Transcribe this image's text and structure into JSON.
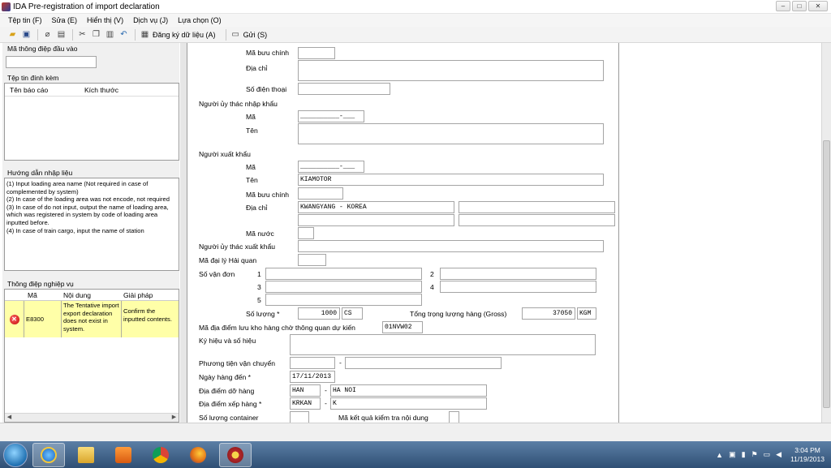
{
  "window": {
    "title": "IDA Pre-registration of import declaration",
    "buttons": [
      "–",
      "□",
      "✕"
    ]
  },
  "menu": [
    "Tệp tin (F)",
    "Sửa (E)",
    "Hiển thị (V)",
    "Dịch vụ (J)",
    "Lựa chọn (O)"
  ],
  "toolbar": {
    "register_label": "Đăng ký dữ liệu (A)",
    "send_label": "Gửi (S)"
  },
  "left": {
    "input_message_label": "Mã thông điệp đầu vào",
    "attachments_label": "Tệp tin đính kèm",
    "attachments_cols": [
      "Tên báo cáo",
      "Kích thước"
    ],
    "guide_label": "Hướng dẫn nhập liệu",
    "guide_text": "(1) Input loading area name (Not required in case of complemented by system)\n(2) In case of the loading area was not encode, not required\n(3) In case of do not input, output the name of loading area, which was registered in system by code of loading area inputted before.\n(4) In case of train cargo, input the name of station",
    "business_label": "Thông điệp nghiệp vụ",
    "business_cols": [
      "Mã",
      "Nội dung",
      "Giải pháp"
    ],
    "business_row": {
      "code": "E8300",
      "content": "The Tentative import export declaration does not exist in system.",
      "solution": "Confirm the inputted contents."
    }
  },
  "form": {
    "postcode_label": "Mã bưu chính",
    "address_label": "Địa chỉ",
    "phone_label": "Số điện thoại",
    "importer_entrust_label": "Người ủy thác nhập khẩu",
    "code_label": "Mã",
    "name_label": "Tên",
    "code_mask": "__________-___",
    "exporter_label": "Người xuất khẩu",
    "exporter_name": "KIAMOTOR",
    "exporter_address": "KWANGYANG - KOREA",
    "country_label": "Mã nước",
    "exporter_entrust_label": "Người ủy thác xuất khẩu",
    "customs_agent_label": "Mã đại lý Hải quan",
    "bill_label": "Số vận đơn",
    "bill_nums": [
      "1",
      "2",
      "3",
      "4",
      "5"
    ],
    "quantity_label": "Số lượng *",
    "quantity": "1000",
    "quantity_unit": "CS",
    "gross_label": "Tổng trọng lượng hàng (Gross)",
    "gross": "37050",
    "gross_unit": "KGM",
    "storage_label": "Mã địa điểm lưu kho hàng chờ thông quan dự kiến",
    "storage": "01NVW02",
    "marks_label": "Ký hiệu và số hiệu",
    "transport_label": "Phương tiện vận chuyển",
    "arrival_label": "Ngày hàng đến *",
    "arrival": "17/11/2013",
    "unloading_label": "Địa điểm dỡ hàng",
    "unloading_code": "HAN",
    "unloading_name": "HA NOI",
    "loading_label": "Địa điểm xếp hàng *",
    "loading_code": "KRKAN",
    "loading_name": "K",
    "container_label": "Số lượng container",
    "check_label": "Mã kết quả kiểm tra nội dung",
    "dash": "-"
  },
  "taskbar": {
    "time": "3:04 PM",
    "date": "11/19/2013"
  },
  "colors": {
    "title_bg": "#ffffff",
    "taskbar": "#3d6088",
    "error_row": "#ffffa8"
  }
}
